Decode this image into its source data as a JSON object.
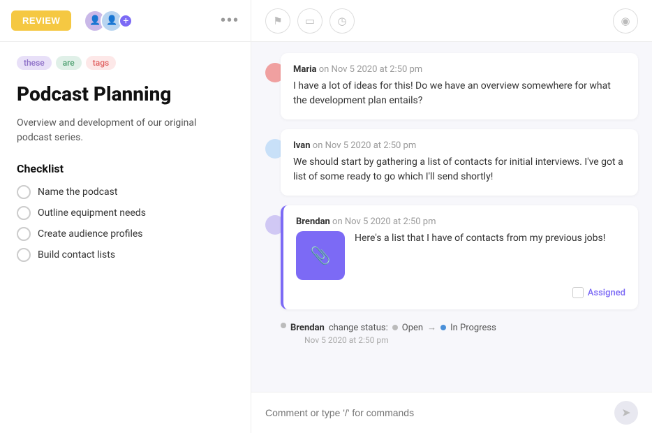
{
  "topbar": {
    "review_label": "REVIEW",
    "more_icon": "•••"
  },
  "toolbar_icons": {
    "flag": "⚑",
    "card": "▭",
    "clock": "◷",
    "eye": "◉"
  },
  "tags": [
    {
      "id": "these",
      "label": "these",
      "class": "tag-these"
    },
    {
      "id": "are",
      "label": "are",
      "class": "tag-are"
    },
    {
      "id": "tags",
      "label": "tags",
      "class": "tag-tags"
    }
  ],
  "page": {
    "title": "Podcast Planning",
    "description": "Overview and development of our original podcast series.",
    "checklist_heading": "Checklist",
    "checklist_items": [
      "Name the podcast",
      "Outline equipment needs",
      "Create audience profiles",
      "Build contact lists"
    ]
  },
  "comments": [
    {
      "id": "maria",
      "author": "Maria",
      "timestamp": "on Nov 5 2020 at 2:50 pm",
      "text": "I have a lot of ideas for this! Do we have an overview somewhere for what the development plan entails?"
    },
    {
      "id": "ivan",
      "author": "Ivan",
      "timestamp": "on Nov 5 2020 at 2:50 pm",
      "text": "We should start by gathering a list of contacts for initial interviews. I've got a list of some ready to go which I'll send shortly!"
    },
    {
      "id": "brendan",
      "author": "Brendan",
      "timestamp": "on Nov 5 2020 at 2:50 pm",
      "text": "Here's a list that I have of contacts from my previous jobs!",
      "has_attachment": true,
      "attachment_icon": "📎",
      "assigned_label": "Assigned"
    }
  ],
  "status_change": {
    "author": "Brendan",
    "action": "change status:",
    "from": "Open",
    "to": "In Progress",
    "timestamp": "Nov 5 2020 at 2:50 pm"
  },
  "comment_input": {
    "placeholder": "Comment or type '/' for commands"
  }
}
